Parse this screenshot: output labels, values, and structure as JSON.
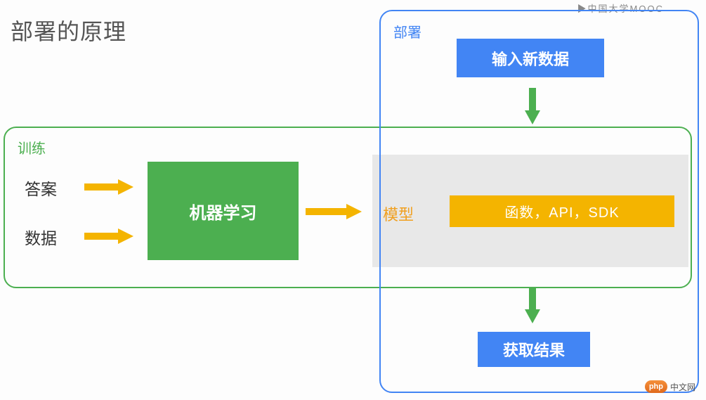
{
  "title": "部署的原理",
  "watermark_top": "▶中国大学MOOC",
  "training": {
    "label": "训练",
    "answer": "答案",
    "data": "数据",
    "ml": "机器学习"
  },
  "deploy": {
    "label": "部署",
    "input": "输入新数据",
    "model": "模型",
    "func": "函数，API，SDK",
    "result": "获取结果"
  },
  "colors": {
    "green": "#4CAF50",
    "blue": "#4285F4",
    "orange": "#F4B400",
    "text_orange": "#F0A020"
  },
  "watermark": {
    "badge": "php",
    "text": "中文网"
  }
}
